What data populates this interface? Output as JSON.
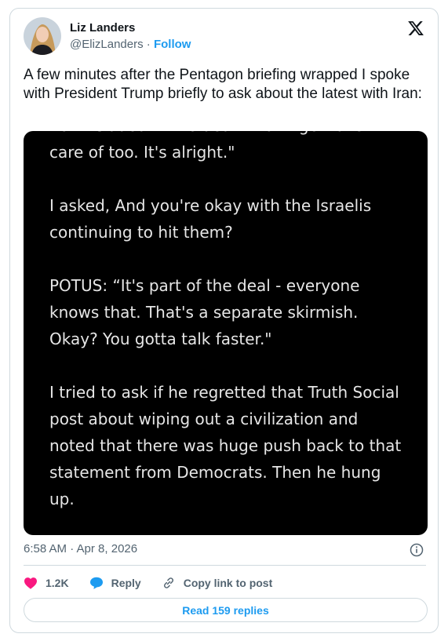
{
  "author": {
    "name": "Liz Landers",
    "handle": "@ElizLanders",
    "separator": "·",
    "follow_label": "Follow"
  },
  "tweet": {
    "text": "A few minutes after the Pentagon briefing wrapped I spoke with President Trump briefly to ask about the latest with Iran:",
    "image_text": "not included in the deal. That'll get taken\ncare of too. It's alright.\"\n\nI asked, And you're okay with the Israelis\ncontinuing to hit them?\n\nPOTUS: “It's part of the deal - everyone\nknows that. That's a separate skirmish.\nOkay? You gotta talk faster.\"\n\nI tried to ask if he regretted that Truth Social\npost about wiping out a civilization and\nnoted that there was huge push back to that\nstatement from Democrats. Then he hung\nup.",
    "timestamp": "6:58 AM · Apr 8, 2026"
  },
  "actions": {
    "likes": "1.2K",
    "reply_label": "Reply",
    "copy_link_label": "Copy link to post"
  },
  "footer": {
    "read_replies_label": "Read 159 replies"
  },
  "icons": {
    "x_logo": "x-logo-icon",
    "info": "info-icon",
    "heart": "heart-icon",
    "reply": "reply-bubble-icon",
    "link": "link-icon"
  },
  "colors": {
    "accent": "#1d9bf0",
    "like": "#f91880",
    "muted": "#536471",
    "border": "#cfd9de"
  }
}
